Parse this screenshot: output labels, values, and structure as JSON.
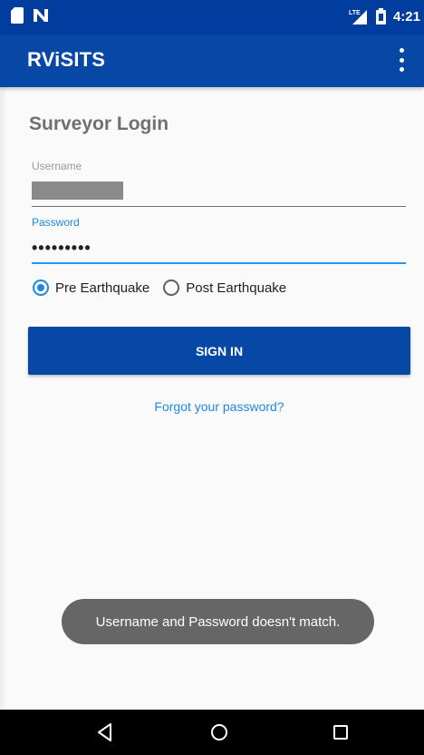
{
  "status_bar": {
    "time": "4:21",
    "network_label": "LTE",
    "left_icons": [
      "sim-card-icon",
      "n-notification-icon"
    ],
    "right_icons": [
      "lte-signal-icon",
      "battery-icon"
    ]
  },
  "app_bar": {
    "title": "RViSITS",
    "overflow_icon": "more-vert-icon"
  },
  "form": {
    "title": "Surveyor Login",
    "username_label": "Username",
    "password_label": "Password",
    "password_value": "•••••••••",
    "radio_options": [
      {
        "label": "Pre Earthquake",
        "checked": true
      },
      {
        "label": "Post Earthquake",
        "checked": false
      }
    ],
    "sign_in_label": "SIGN IN",
    "forgot_password_label": "Forgot your password?"
  },
  "toast": {
    "message": "Username and Password doesn't match."
  },
  "nav_bar": {
    "buttons": [
      "back-icon",
      "home-icon",
      "recents-icon"
    ]
  },
  "colors": {
    "status_bar": "#003d9e",
    "app_bar": "#0747a6",
    "accent": "#1e88e5",
    "toast": "#666666"
  }
}
